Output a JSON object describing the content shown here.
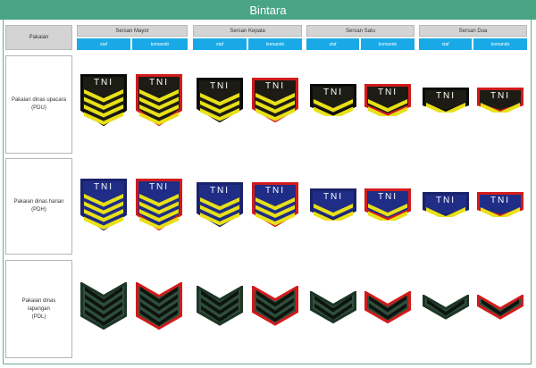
{
  "title": "Bintara",
  "header": {
    "row_header": "Pakaian",
    "ranks": [
      {
        "name": "Sersan Mayor",
        "staf": "staf",
        "komando": "komando"
      },
      {
        "name": "Sersan Kepala",
        "staf": "staf",
        "komando": "komando"
      },
      {
        "name": "Sersan Satu",
        "staf": "staf",
        "komando": "komando"
      },
      {
        "name": "Sersan Dua",
        "staf": "staf",
        "komando": "komando"
      }
    ]
  },
  "rows": [
    {
      "lines": [
        "Pakaian dinas upacara",
        "(PDU)"
      ]
    },
    {
      "lines": [
        "Pakaian dinas harian",
        "(PDH)"
      ]
    },
    {
      "lines": [
        "Pakaian dinas",
        "lapangan",
        "(PDL)"
      ]
    }
  ],
  "badge_text": "TNI",
  "chevron_counts": [
    4,
    3,
    2,
    1
  ],
  "colors": {
    "title_bar": "#4aa587",
    "sub_header": "#19a9e6",
    "pdu_background": "#1c1c14",
    "pdh_background": "#1f2d86",
    "pdl_background": "#2f4f3c",
    "stripe_yellow": "#e8e018",
    "stripe_pdl": "#0d140f",
    "komando_border": "#d11b1b",
    "staf_border_pdu": "#0a0a0a",
    "staf_border_pdh": "#1a226a",
    "staf_border_pdl": "#1d3527"
  }
}
